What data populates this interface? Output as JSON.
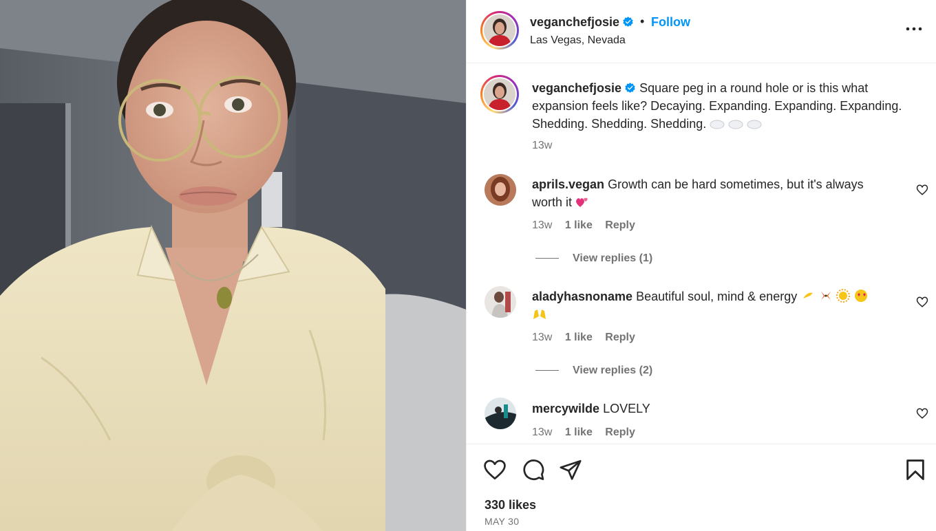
{
  "post": {
    "username": "veganchefjosie",
    "separator": "•",
    "follow_label": "Follow",
    "location": "Las Vegas, Nevada",
    "more_icon": "more-horizontal-icon"
  },
  "caption": {
    "username": "veganchefjosie",
    "text": "Square peg in a round hole or is this what expansion feels like? Decaying. Expanding. Expanding. Expanding. Shedding. Shedding. Shedding.",
    "time": "13w"
  },
  "comments": [
    {
      "username": "aprils.vegan",
      "text": "Growth can be hard sometimes, but it's always worth it",
      "time": "13w",
      "likes": "1 like",
      "reply_label": "Reply",
      "view_replies": "View replies (1)"
    },
    {
      "username": "aladyhasnoname",
      "text": "Beautiful soul, mind & energy",
      "time": "13w",
      "likes": "1 like",
      "reply_label": "Reply",
      "view_replies": "View replies (2)"
    },
    {
      "username": "mercywilde",
      "text": "LOVELY",
      "time": "13w",
      "likes": "1 like",
      "reply_label": "Reply"
    }
  ],
  "footer": {
    "likes": "330 likes",
    "date": "MAY 30"
  },
  "colors": {
    "link_blue": "#0095f6",
    "verified_blue": "#0095f6",
    "text": "#262626",
    "secondary": "#737373"
  }
}
